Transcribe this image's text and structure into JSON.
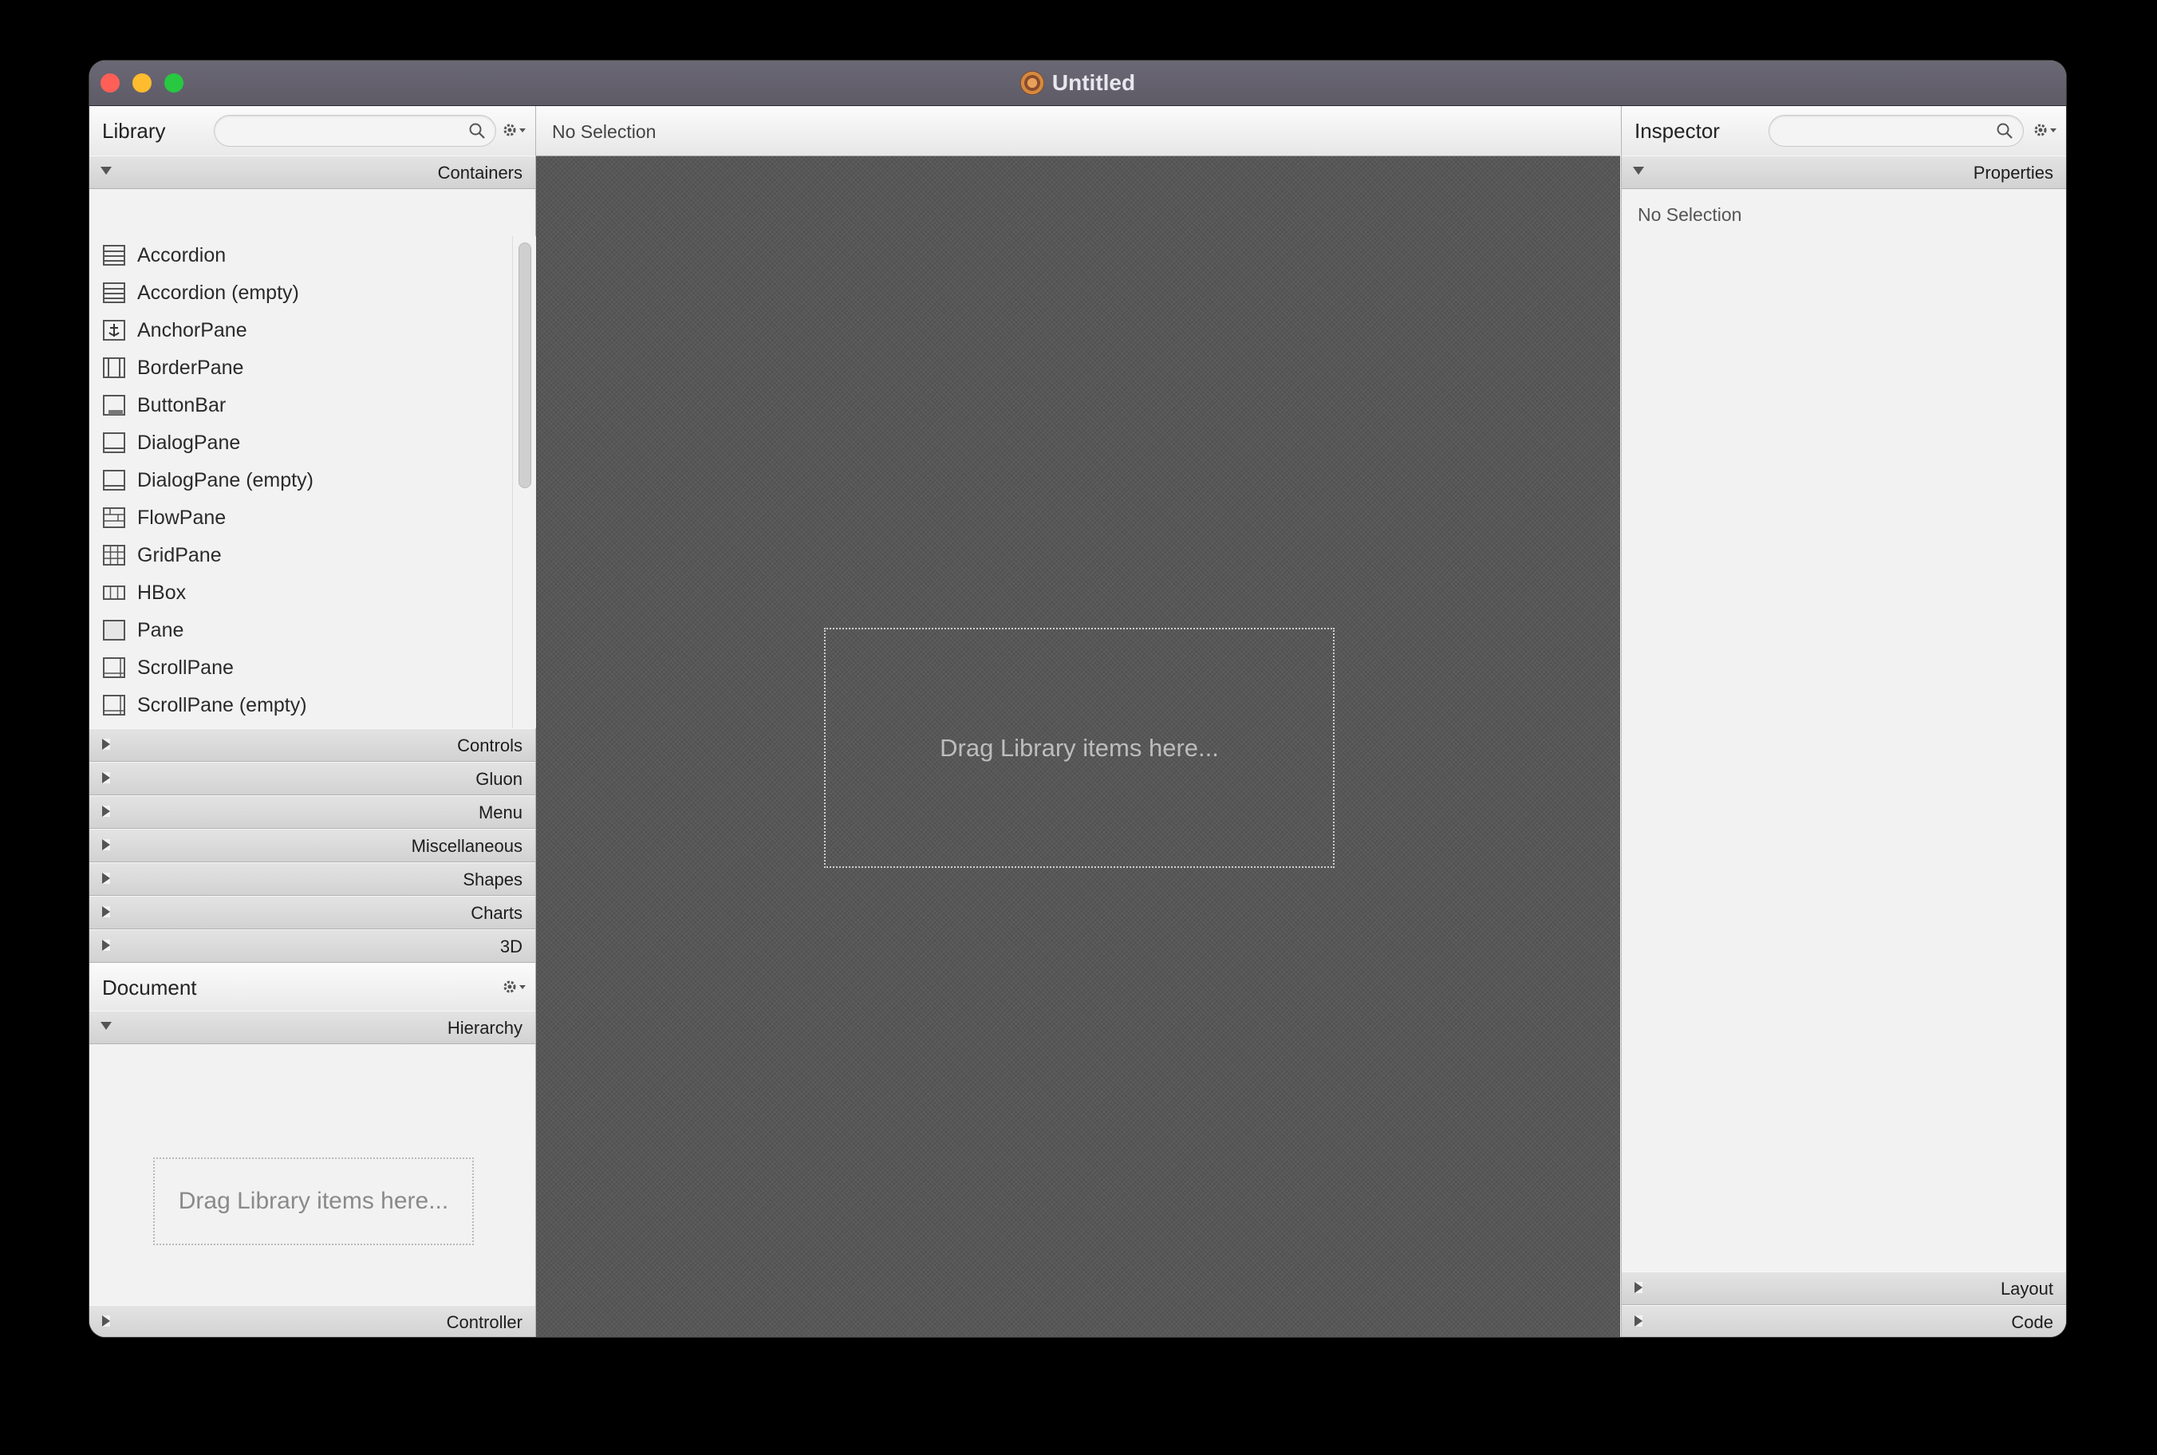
{
  "window": {
    "title": "Untitled"
  },
  "library": {
    "title": "Library",
    "search_placeholder": "",
    "sections": {
      "containers": "Containers",
      "controls": "Controls",
      "gluon": "Gluon",
      "menu": "Menu",
      "miscellaneous": "Miscellaneous",
      "shapes": "Shapes",
      "charts": "Charts",
      "three_d": "3D"
    },
    "items": [
      {
        "label": "Accordion",
        "icon": "accordion-icon"
      },
      {
        "label": "Accordion  (empty)",
        "icon": "accordion-icon"
      },
      {
        "label": "AnchorPane",
        "icon": "anchor-pane-icon"
      },
      {
        "label": "BorderPane",
        "icon": "border-pane-icon"
      },
      {
        "label": "ButtonBar",
        "icon": "button-bar-icon"
      },
      {
        "label": "DialogPane",
        "icon": "dialog-pane-icon"
      },
      {
        "label": "DialogPane  (empty)",
        "icon": "dialog-pane-icon"
      },
      {
        "label": "FlowPane",
        "icon": "flow-pane-icon"
      },
      {
        "label": "GridPane",
        "icon": "grid-pane-icon"
      },
      {
        "label": "HBox",
        "icon": "hbox-icon"
      },
      {
        "label": "Pane",
        "icon": "pane-icon"
      },
      {
        "label": "ScrollPane",
        "icon": "scroll-pane-icon"
      },
      {
        "label": "ScrollPane  (empty)",
        "icon": "scroll-pane-icon"
      }
    ]
  },
  "document": {
    "title": "Document",
    "sections": {
      "hierarchy": "Hierarchy",
      "controller": "Controller"
    },
    "drop_hint": "Drag Library items here..."
  },
  "canvas": {
    "selection_text": "No Selection",
    "drop_hint": "Drag Library items here..."
  },
  "inspector": {
    "title": "Inspector",
    "search_placeholder": "",
    "sections": {
      "properties": "Properties",
      "layout": "Layout",
      "code": "Code"
    },
    "no_selection": "No Selection"
  }
}
